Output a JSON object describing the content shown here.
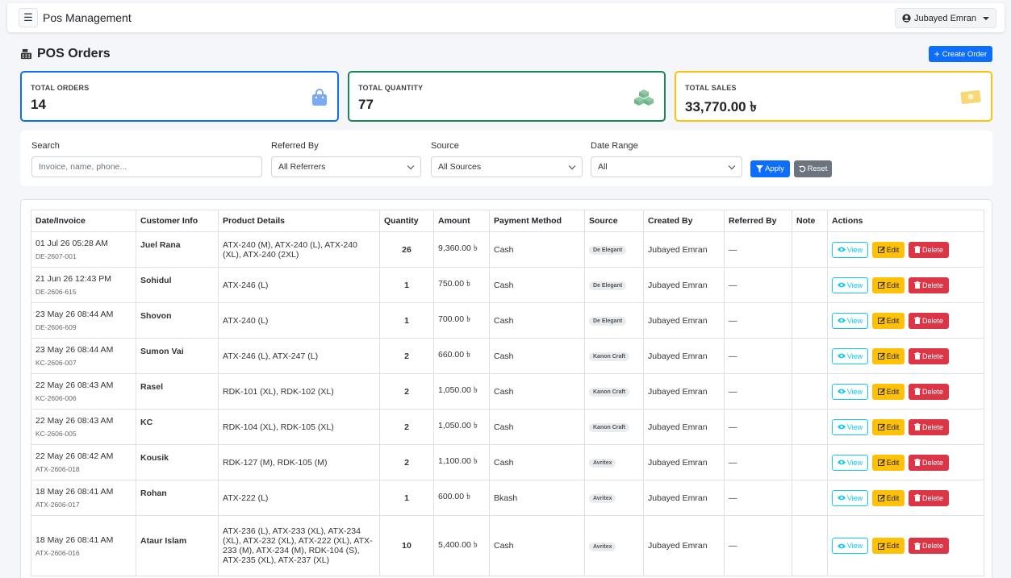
{
  "app": {
    "title": "Pos Management",
    "user_name": "Jubayed Emran"
  },
  "page": {
    "title": "POS Orders",
    "create_label": "Create Order"
  },
  "stats": {
    "orders": {
      "label": "TOTAL ORDERS",
      "value": "14"
    },
    "quantity": {
      "label": "TOTAL QUANTITY",
      "value": "77"
    },
    "sales": {
      "label": "TOTAL SALES",
      "value": "33,770.00 ৳"
    }
  },
  "colors": {
    "primary": "#0d6efd",
    "success": "#198754",
    "warning": "#ffc107",
    "danger": "#dc3545",
    "info": "#0dcaf0",
    "secondary": "#6c757d"
  },
  "filters": {
    "search": {
      "label": "Search",
      "placeholder": "Invoice, name, phone..."
    },
    "referred_by": {
      "label": "Referred By",
      "value": "All Referrers"
    },
    "source": {
      "label": "Source",
      "value": "All Sources"
    },
    "date_range": {
      "label": "Date Range",
      "value": "All"
    },
    "apply_label": "Apply",
    "reset_label": "Reset"
  },
  "table": {
    "headers": [
      "Date/Invoice",
      "Customer Info",
      "Product Details",
      "Quantity",
      "Amount",
      "Payment Method",
      "Source",
      "Created By",
      "Referred By",
      "Note",
      "Actions"
    ],
    "action_labels": {
      "view": "View",
      "edit": "Edit",
      "delete": "Delete"
    },
    "rows": [
      {
        "date": "01 Jul 26 05:28 AM",
        "invoice": "DE-2607-001",
        "customer": "Juel Rana",
        "products": "ATX-240 (M), ATX-240 (L), ATX-240 (XL), ATX-240 (2XL)",
        "quantity": "26",
        "amount": "9,360.00 ৳",
        "payment": "Cash",
        "source": "De Elegant",
        "created_by": "Jubayed Emran",
        "referred_by": "—",
        "note": ""
      },
      {
        "date": "21 Jun 26 12:43 PM",
        "invoice": "DE-2606-615",
        "customer": "Sohidul",
        "products": "ATX-246 (L)",
        "quantity": "1",
        "amount": "750.00 ৳",
        "payment": "Cash",
        "source": "De Elegant",
        "created_by": "Jubayed Emran",
        "referred_by": "—",
        "note": ""
      },
      {
        "date": "23 May 26 08:44 AM",
        "invoice": "DE-2606-609",
        "customer": "Shovon",
        "products": "ATX-240 (L)",
        "quantity": "1",
        "amount": "700.00 ৳",
        "payment": "Cash",
        "source": "De Elegant",
        "created_by": "Jubayed Emran",
        "referred_by": "—",
        "note": ""
      },
      {
        "date": "23 May 26 08:44 AM",
        "invoice": "KC-2606-007",
        "customer": "Sumon Vai",
        "products": "ATX-246 (L), ATX-247 (L)",
        "quantity": "2",
        "amount": "660.00 ৳",
        "payment": "Cash",
        "source": "Kanon Craft",
        "created_by": "Jubayed Emran",
        "referred_by": "—",
        "note": ""
      },
      {
        "date": "22 May 26 08:43 AM",
        "invoice": "KC-2606-006",
        "customer": "Rasel",
        "products": "RDK-101 (XL), RDK-102 (XL)",
        "quantity": "2",
        "amount": "1,050.00 ৳",
        "payment": "Cash",
        "source": "Kanon Craft",
        "created_by": "Jubayed Emran",
        "referred_by": "—",
        "note": ""
      },
      {
        "date": "22 May 26 08:43 AM",
        "invoice": "KC-2606-005",
        "customer": "KC",
        "products": "RDK-104 (XL), RDK-105 (XL)",
        "quantity": "2",
        "amount": "1,050.00 ৳",
        "payment": "Cash",
        "source": "Kanon Craft",
        "created_by": "Jubayed Emran",
        "referred_by": "—",
        "note": ""
      },
      {
        "date": "22 May 26 08:42 AM",
        "invoice": "ATX-2606-018",
        "customer": "Kousik",
        "products": "RDK-127 (M), RDK-105 (M)",
        "quantity": "2",
        "amount": "1,100.00 ৳",
        "payment": "Cash",
        "source": "Avritex",
        "created_by": "Jubayed Emran",
        "referred_by": "—",
        "note": ""
      },
      {
        "date": "18 May 26 08:41 AM",
        "invoice": "ATX-2606-017",
        "customer": "Rohan",
        "products": "ATX-222 (L)",
        "quantity": "1",
        "amount": "600.00 ৳",
        "payment": "Bkash",
        "source": "Avritex",
        "created_by": "Jubayed Emran",
        "referred_by": "—",
        "note": ""
      },
      {
        "date": "18 May 26 08:41 AM",
        "invoice": "ATX-2606-016",
        "customer": "Ataur Islam",
        "products": "ATX-236 (L), ATX-233 (XL), ATX-234 (XL), ATX-232 (XL), ATX-222 (XL), ATX-233 (M), ATX-234 (M), RDK-104 (S), ATX-235 (XL), ATX-237 (XL)",
        "quantity": "10",
        "amount": "5,400.00 ৳",
        "payment": "Cash",
        "source": "Avritex",
        "created_by": "Jubayed Emran",
        "referred_by": "—",
        "note": ""
      }
    ]
  }
}
